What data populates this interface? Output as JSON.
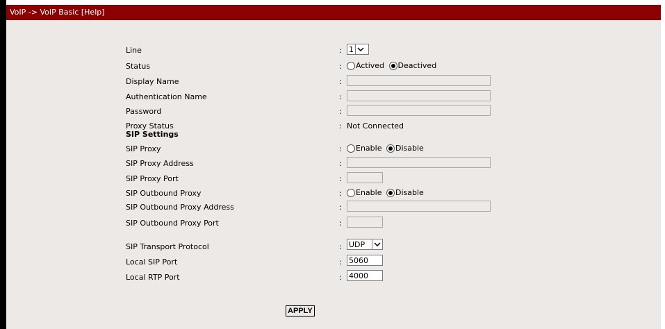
{
  "header": {
    "breadcrumb": "VoIP -> VoIP Basic",
    "help_link": "[Help]"
  },
  "form": {
    "line": {
      "label": "Line",
      "value": "1"
    },
    "status": {
      "label": "Status",
      "options": [
        "Actived",
        "Deactived"
      ],
      "selected": "Deactived"
    },
    "display_name": {
      "label": "Display Name",
      "value": ""
    },
    "auth_name": {
      "label": "Authentication Name",
      "value": ""
    },
    "password": {
      "label": "Password",
      "value": ""
    },
    "proxy_status": {
      "label": "Proxy Status",
      "value": "Not Connected"
    },
    "sip_section": {
      "label": "SIP Settings"
    },
    "sip_proxy": {
      "label": "SIP Proxy",
      "options": [
        "Enable",
        "Disable"
      ],
      "selected": "Disable"
    },
    "sip_proxy_address": {
      "label": "SIP Proxy Address",
      "value": ""
    },
    "sip_proxy_port": {
      "label": "SIP Proxy Port",
      "value": ""
    },
    "sip_outbound_proxy": {
      "label": "SIP Outbound Proxy",
      "options": [
        "Enable",
        "Disable"
      ],
      "selected": "Disable"
    },
    "sip_outbound_proxy_address": {
      "label": "SIP Outbound Proxy Address",
      "value": ""
    },
    "sip_outbound_proxy_port": {
      "label": "SIP Outbound Proxy Port",
      "value": ""
    },
    "sip_transport": {
      "label": "SIP Transport Protocol",
      "value": "UDP"
    },
    "local_sip_port": {
      "label": "Local SIP Port",
      "value": "5060"
    },
    "local_rtp_port": {
      "label": "Local RTP Port",
      "value": "4000"
    },
    "colon": ":"
  },
  "actions": {
    "apply_label": "APPLY"
  },
  "colors": {
    "title_bar": "#8b0000",
    "panel": "#ece9e6"
  }
}
